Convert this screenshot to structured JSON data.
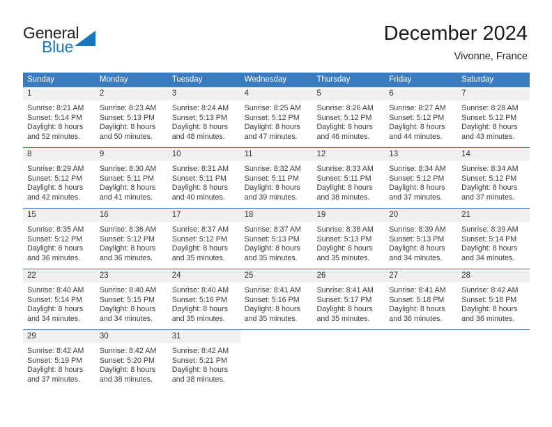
{
  "brand": {
    "name_part1": "General",
    "name_part2": "Blue",
    "logo_icon": "triangle-flag-icon",
    "accent_color": "#1b75bb"
  },
  "header": {
    "title": "December 2024",
    "location": "Vivonne, France"
  },
  "theme": {
    "header_blue": "#3b7cc0",
    "daynum_band": "#f0f0f0",
    "text": "#3a3a3a"
  },
  "weekday_headers": [
    "Sunday",
    "Monday",
    "Tuesday",
    "Wednesday",
    "Thursday",
    "Friday",
    "Saturday"
  ],
  "weeks": [
    [
      {
        "day": "1",
        "sunrise": "Sunrise: 8:21 AM",
        "sunset": "Sunset: 5:14 PM",
        "daylight1": "Daylight: 8 hours",
        "daylight2": "and 52 minutes."
      },
      {
        "day": "2",
        "sunrise": "Sunrise: 8:23 AM",
        "sunset": "Sunset: 5:13 PM",
        "daylight1": "Daylight: 8 hours",
        "daylight2": "and 50 minutes."
      },
      {
        "day": "3",
        "sunrise": "Sunrise: 8:24 AM",
        "sunset": "Sunset: 5:13 PM",
        "daylight1": "Daylight: 8 hours",
        "daylight2": "and 48 minutes."
      },
      {
        "day": "4",
        "sunrise": "Sunrise: 8:25 AM",
        "sunset": "Sunset: 5:12 PM",
        "daylight1": "Daylight: 8 hours",
        "daylight2": "and 47 minutes."
      },
      {
        "day": "5",
        "sunrise": "Sunrise: 8:26 AM",
        "sunset": "Sunset: 5:12 PM",
        "daylight1": "Daylight: 8 hours",
        "daylight2": "and 46 minutes."
      },
      {
        "day": "6",
        "sunrise": "Sunrise: 8:27 AM",
        "sunset": "Sunset: 5:12 PM",
        "daylight1": "Daylight: 8 hours",
        "daylight2": "and 44 minutes."
      },
      {
        "day": "7",
        "sunrise": "Sunrise: 8:28 AM",
        "sunset": "Sunset: 5:12 PM",
        "daylight1": "Daylight: 8 hours",
        "daylight2": "and 43 minutes."
      }
    ],
    [
      {
        "day": "8",
        "sunrise": "Sunrise: 8:29 AM",
        "sunset": "Sunset: 5:12 PM",
        "daylight1": "Daylight: 8 hours",
        "daylight2": "and 42 minutes."
      },
      {
        "day": "9",
        "sunrise": "Sunrise: 8:30 AM",
        "sunset": "Sunset: 5:11 PM",
        "daylight1": "Daylight: 8 hours",
        "daylight2": "and 41 minutes."
      },
      {
        "day": "10",
        "sunrise": "Sunrise: 8:31 AM",
        "sunset": "Sunset: 5:11 PM",
        "daylight1": "Daylight: 8 hours",
        "daylight2": "and 40 minutes."
      },
      {
        "day": "11",
        "sunrise": "Sunrise: 8:32 AM",
        "sunset": "Sunset: 5:11 PM",
        "daylight1": "Daylight: 8 hours",
        "daylight2": "and 39 minutes."
      },
      {
        "day": "12",
        "sunrise": "Sunrise: 8:33 AM",
        "sunset": "Sunset: 5:11 PM",
        "daylight1": "Daylight: 8 hours",
        "daylight2": "and 38 minutes."
      },
      {
        "day": "13",
        "sunrise": "Sunrise: 8:34 AM",
        "sunset": "Sunset: 5:12 PM",
        "daylight1": "Daylight: 8 hours",
        "daylight2": "and 37 minutes."
      },
      {
        "day": "14",
        "sunrise": "Sunrise: 8:34 AM",
        "sunset": "Sunset: 5:12 PM",
        "daylight1": "Daylight: 8 hours",
        "daylight2": "and 37 minutes."
      }
    ],
    [
      {
        "day": "15",
        "sunrise": "Sunrise: 8:35 AM",
        "sunset": "Sunset: 5:12 PM",
        "daylight1": "Daylight: 8 hours",
        "daylight2": "and 36 minutes."
      },
      {
        "day": "16",
        "sunrise": "Sunrise: 8:36 AM",
        "sunset": "Sunset: 5:12 PM",
        "daylight1": "Daylight: 8 hours",
        "daylight2": "and 36 minutes."
      },
      {
        "day": "17",
        "sunrise": "Sunrise: 8:37 AM",
        "sunset": "Sunset: 5:12 PM",
        "daylight1": "Daylight: 8 hours",
        "daylight2": "and 35 minutes."
      },
      {
        "day": "18",
        "sunrise": "Sunrise: 8:37 AM",
        "sunset": "Sunset: 5:13 PM",
        "daylight1": "Daylight: 8 hours",
        "daylight2": "and 35 minutes."
      },
      {
        "day": "19",
        "sunrise": "Sunrise: 8:38 AM",
        "sunset": "Sunset: 5:13 PM",
        "daylight1": "Daylight: 8 hours",
        "daylight2": "and 35 minutes."
      },
      {
        "day": "20",
        "sunrise": "Sunrise: 8:39 AM",
        "sunset": "Sunset: 5:13 PM",
        "daylight1": "Daylight: 8 hours",
        "daylight2": "and 34 minutes."
      },
      {
        "day": "21",
        "sunrise": "Sunrise: 8:39 AM",
        "sunset": "Sunset: 5:14 PM",
        "daylight1": "Daylight: 8 hours",
        "daylight2": "and 34 minutes."
      }
    ],
    [
      {
        "day": "22",
        "sunrise": "Sunrise: 8:40 AM",
        "sunset": "Sunset: 5:14 PM",
        "daylight1": "Daylight: 8 hours",
        "daylight2": "and 34 minutes."
      },
      {
        "day": "23",
        "sunrise": "Sunrise: 8:40 AM",
        "sunset": "Sunset: 5:15 PM",
        "daylight1": "Daylight: 8 hours",
        "daylight2": "and 34 minutes."
      },
      {
        "day": "24",
        "sunrise": "Sunrise: 8:40 AM",
        "sunset": "Sunset: 5:16 PM",
        "daylight1": "Daylight: 8 hours",
        "daylight2": "and 35 minutes."
      },
      {
        "day": "25",
        "sunrise": "Sunrise: 8:41 AM",
        "sunset": "Sunset: 5:16 PM",
        "daylight1": "Daylight: 8 hours",
        "daylight2": "and 35 minutes."
      },
      {
        "day": "26",
        "sunrise": "Sunrise: 8:41 AM",
        "sunset": "Sunset: 5:17 PM",
        "daylight1": "Daylight: 8 hours",
        "daylight2": "and 35 minutes."
      },
      {
        "day": "27",
        "sunrise": "Sunrise: 8:41 AM",
        "sunset": "Sunset: 5:18 PM",
        "daylight1": "Daylight: 8 hours",
        "daylight2": "and 36 minutes."
      },
      {
        "day": "28",
        "sunrise": "Sunrise: 8:42 AM",
        "sunset": "Sunset: 5:18 PM",
        "daylight1": "Daylight: 8 hours",
        "daylight2": "and 36 minutes."
      }
    ],
    [
      {
        "day": "29",
        "sunrise": "Sunrise: 8:42 AM",
        "sunset": "Sunset: 5:19 PM",
        "daylight1": "Daylight: 8 hours",
        "daylight2": "and 37 minutes."
      },
      {
        "day": "30",
        "sunrise": "Sunrise: 8:42 AM",
        "sunset": "Sunset: 5:20 PM",
        "daylight1": "Daylight: 8 hours",
        "daylight2": "and 38 minutes."
      },
      {
        "day": "31",
        "sunrise": "Sunrise: 8:42 AM",
        "sunset": "Sunset: 5:21 PM",
        "daylight1": "Daylight: 8 hours",
        "daylight2": "and 38 minutes."
      },
      {
        "day": "",
        "sunrise": "",
        "sunset": "",
        "daylight1": "",
        "daylight2": ""
      },
      {
        "day": "",
        "sunrise": "",
        "sunset": "",
        "daylight1": "",
        "daylight2": ""
      },
      {
        "day": "",
        "sunrise": "",
        "sunset": "",
        "daylight1": "",
        "daylight2": ""
      },
      {
        "day": "",
        "sunrise": "",
        "sunset": "",
        "daylight1": "",
        "daylight2": ""
      }
    ]
  ]
}
